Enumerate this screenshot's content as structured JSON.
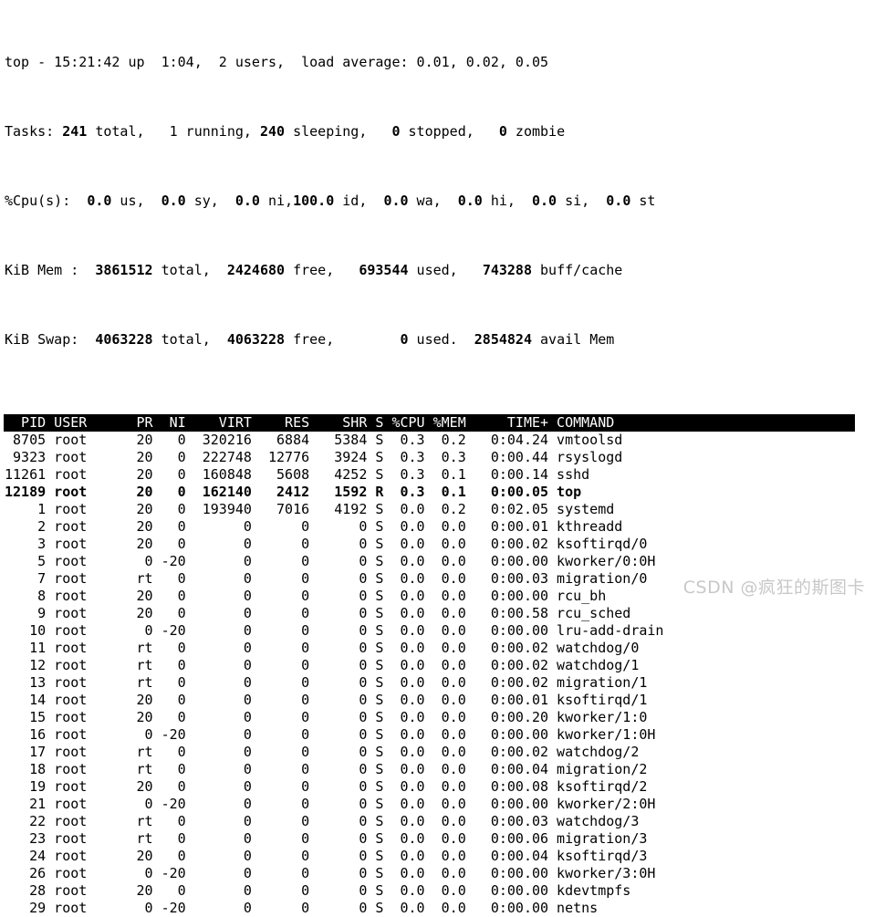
{
  "terminal": {
    "background": "#ffffff",
    "foreground": "#000000",
    "header_bar_background": "#000000",
    "header_bar_foreground": "#ffffff"
  },
  "summary": {
    "uptime_line": {
      "program": "top",
      "time": "15:21:42",
      "up": "1:04",
      "users": "2 users",
      "load_average": "0.01, 0.02, 0.05",
      "text_prefix": "top - 15:21:42 up  1:04,  2 users,  load average: ",
      "text_full": "top - 15:21:42 up  1:04,  2 users,  load average: 0.01, 0.02, 0.05"
    },
    "tasks_line": {
      "label": "Tasks:",
      "total": "241",
      "total_label": " total,   ",
      "running": "1",
      "running_label": " running, ",
      "sleeping": "240",
      "sleeping_label": " sleeping,   ",
      "stopped": "0",
      "stopped_label": " stopped,   ",
      "zombie": "0",
      "zombie_label": " zombie"
    },
    "cpu_line": {
      "label": "%Cpu(s):  ",
      "us": "0.0",
      "us_label": " us,  ",
      "sy": "0.0",
      "sy_label": " sy,  ",
      "ni": "0.0",
      "ni_label": " ni,",
      "id": "100.0",
      "id_label": " id,  ",
      "wa": "0.0",
      "wa_label": " wa,  ",
      "hi": "0.0",
      "hi_label": " hi,  ",
      "si": "0.0",
      "si_label": " si,  ",
      "st": "0.0",
      "st_label": " st"
    },
    "mem_line": {
      "label": "KiB Mem :  ",
      "total": "3861512",
      "total_label": " total,  ",
      "free": "2424680",
      "free_label": " free,   ",
      "used": "693544",
      "used_label": " used,   ",
      "buffcache": "743288",
      "buffcache_label": " buff/cache"
    },
    "swap_line": {
      "label": "KiB Swap:  ",
      "total": "4063228",
      "total_label": " total,  ",
      "free": "4063228",
      "free_label": " free,        ",
      "used": "0",
      "used_label": " used.  ",
      "avail": "2854824",
      "avail_label": " avail Mem"
    }
  },
  "table": {
    "header_text": "  PID USER      PR  NI    VIRT    RES    SHR S %CPU %MEM     TIME+ COMMAND                  ",
    "columns": [
      "PID",
      "USER",
      "PR",
      "NI",
      "VIRT",
      "RES",
      "SHR",
      "S",
      "%CPU",
      "%MEM",
      "TIME+",
      "COMMAND"
    ],
    "rows": [
      {
        "line": " 8705 root      20   0  320216   6884   5384 S  0.3  0.2   0:04.24 vmtoolsd",
        "pid": "8705",
        "user": "root",
        "pr": "20",
        "ni": "0",
        "virt": "320216",
        "res": "6884",
        "shr": "5384",
        "s": "S",
        "cpu": "0.3",
        "mem": "0.2",
        "time": "0:04.24",
        "command": "vmtoolsd",
        "bold": false
      },
      {
        "line": " 9323 root      20   0  222748  12776   3924 S  0.3  0.3   0:00.44 rsyslogd",
        "pid": "9323",
        "user": "root",
        "pr": "20",
        "ni": "0",
        "virt": "222748",
        "res": "12776",
        "shr": "3924",
        "s": "S",
        "cpu": "0.3",
        "mem": "0.3",
        "time": "0:00.44",
        "command": "rsyslogd",
        "bold": false
      },
      {
        "line": "11261 root      20   0  160848   5608   4252 S  0.3  0.1   0:00.14 sshd",
        "pid": "11261",
        "user": "root",
        "pr": "20",
        "ni": "0",
        "virt": "160848",
        "res": "5608",
        "shr": "4252",
        "s": "S",
        "cpu": "0.3",
        "mem": "0.1",
        "time": "0:00.14",
        "command": "sshd",
        "bold": false
      },
      {
        "line": "12189 root      20   0  162140   2412   1592 R  0.3  0.1   0:00.05 top",
        "pid": "12189",
        "user": "root",
        "pr": "20",
        "ni": "0",
        "virt": "162140",
        "res": "2412",
        "shr": "1592",
        "s": "R",
        "cpu": "0.3",
        "mem": "0.1",
        "time": "0:00.05",
        "command": "top",
        "bold": true
      },
      {
        "line": "    1 root      20   0  193940   7016   4192 S  0.0  0.2   0:02.05 systemd",
        "pid": "1",
        "user": "root",
        "pr": "20",
        "ni": "0",
        "virt": "193940",
        "res": "7016",
        "shr": "4192",
        "s": "S",
        "cpu": "0.0",
        "mem": "0.2",
        "time": "0:02.05",
        "command": "systemd",
        "bold": false
      },
      {
        "line": "    2 root      20   0       0      0      0 S  0.0  0.0   0:00.01 kthreadd",
        "pid": "2",
        "user": "root",
        "pr": "20",
        "ni": "0",
        "virt": "0",
        "res": "0",
        "shr": "0",
        "s": "S",
        "cpu": "0.0",
        "mem": "0.0",
        "time": "0:00.01",
        "command": "kthreadd",
        "bold": false
      },
      {
        "line": "    3 root      20   0       0      0      0 S  0.0  0.0   0:00.02 ksoftirqd/0",
        "pid": "3",
        "user": "root",
        "pr": "20",
        "ni": "0",
        "virt": "0",
        "res": "0",
        "shr": "0",
        "s": "S",
        "cpu": "0.0",
        "mem": "0.0",
        "time": "0:00.02",
        "command": "ksoftirqd/0",
        "bold": false
      },
      {
        "line": "    5 root       0 -20       0      0      0 S  0.0  0.0   0:00.00 kworker/0:0H",
        "pid": "5",
        "user": "root",
        "pr": "0",
        "ni": "-20",
        "virt": "0",
        "res": "0",
        "shr": "0",
        "s": "S",
        "cpu": "0.0",
        "mem": "0.0",
        "time": "0:00.00",
        "command": "kworker/0:0H",
        "bold": false
      },
      {
        "line": "    7 root      rt   0       0      0      0 S  0.0  0.0   0:00.03 migration/0",
        "pid": "7",
        "user": "root",
        "pr": "rt",
        "ni": "0",
        "virt": "0",
        "res": "0",
        "shr": "0",
        "s": "S",
        "cpu": "0.0",
        "mem": "0.0",
        "time": "0:00.03",
        "command": "migration/0",
        "bold": false
      },
      {
        "line": "    8 root      20   0       0      0      0 S  0.0  0.0   0:00.00 rcu_bh",
        "pid": "8",
        "user": "root",
        "pr": "20",
        "ni": "0",
        "virt": "0",
        "res": "0",
        "shr": "0",
        "s": "S",
        "cpu": "0.0",
        "mem": "0.0",
        "time": "0:00.00",
        "command": "rcu_bh",
        "bold": false
      },
      {
        "line": "    9 root      20   0       0      0      0 S  0.0  0.0   0:00.58 rcu_sched",
        "pid": "9",
        "user": "root",
        "pr": "20",
        "ni": "0",
        "virt": "0",
        "res": "0",
        "shr": "0",
        "s": "S",
        "cpu": "0.0",
        "mem": "0.0",
        "time": "0:00.58",
        "command": "rcu_sched",
        "bold": false
      },
      {
        "line": "   10 root       0 -20       0      0      0 S  0.0  0.0   0:00.00 lru-add-drain",
        "pid": "10",
        "user": "root",
        "pr": "0",
        "ni": "-20",
        "virt": "0",
        "res": "0",
        "shr": "0",
        "s": "S",
        "cpu": "0.0",
        "mem": "0.0",
        "time": "0:00.00",
        "command": "lru-add-drain",
        "bold": false
      },
      {
        "line": "   11 root      rt   0       0      0      0 S  0.0  0.0   0:00.02 watchdog/0",
        "pid": "11",
        "user": "root",
        "pr": "rt",
        "ni": "0",
        "virt": "0",
        "res": "0",
        "shr": "0",
        "s": "S",
        "cpu": "0.0",
        "mem": "0.0",
        "time": "0:00.02",
        "command": "watchdog/0",
        "bold": false
      },
      {
        "line": "   12 root      rt   0       0      0      0 S  0.0  0.0   0:00.02 watchdog/1",
        "pid": "12",
        "user": "root",
        "pr": "rt",
        "ni": "0",
        "virt": "0",
        "res": "0",
        "shr": "0",
        "s": "S",
        "cpu": "0.0",
        "mem": "0.0",
        "time": "0:00.02",
        "command": "watchdog/1",
        "bold": false
      },
      {
        "line": "   13 root      rt   0       0      0      0 S  0.0  0.0   0:00.02 migration/1",
        "pid": "13",
        "user": "root",
        "pr": "rt",
        "ni": "0",
        "virt": "0",
        "res": "0",
        "shr": "0",
        "s": "S",
        "cpu": "0.0",
        "mem": "0.0",
        "time": "0:00.02",
        "command": "migration/1",
        "bold": false
      },
      {
        "line": "   14 root      20   0       0      0      0 S  0.0  0.0   0:00.01 ksoftirqd/1",
        "pid": "14",
        "user": "root",
        "pr": "20",
        "ni": "0",
        "virt": "0",
        "res": "0",
        "shr": "0",
        "s": "S",
        "cpu": "0.0",
        "mem": "0.0",
        "time": "0:00.01",
        "command": "ksoftirqd/1",
        "bold": false
      },
      {
        "line": "   15 root      20   0       0      0      0 S  0.0  0.0   0:00.20 kworker/1:0",
        "pid": "15",
        "user": "root",
        "pr": "20",
        "ni": "0",
        "virt": "0",
        "res": "0",
        "shr": "0",
        "s": "S",
        "cpu": "0.0",
        "mem": "0.0",
        "time": "0:00.20",
        "command": "kworker/1:0",
        "bold": false
      },
      {
        "line": "   16 root       0 -20       0      0      0 S  0.0  0.0   0:00.00 kworker/1:0H",
        "pid": "16",
        "user": "root",
        "pr": "0",
        "ni": "-20",
        "virt": "0",
        "res": "0",
        "shr": "0",
        "s": "S",
        "cpu": "0.0",
        "mem": "0.0",
        "time": "0:00.00",
        "command": "kworker/1:0H",
        "bold": false
      },
      {
        "line": "   17 root      rt   0       0      0      0 S  0.0  0.0   0:00.02 watchdog/2",
        "pid": "17",
        "user": "root",
        "pr": "rt",
        "ni": "0",
        "virt": "0",
        "res": "0",
        "shr": "0",
        "s": "S",
        "cpu": "0.0",
        "mem": "0.0",
        "time": "0:00.02",
        "command": "watchdog/2",
        "bold": false
      },
      {
        "line": "   18 root      rt   0       0      0      0 S  0.0  0.0   0:00.04 migration/2",
        "pid": "18",
        "user": "root",
        "pr": "rt",
        "ni": "0",
        "virt": "0",
        "res": "0",
        "shr": "0",
        "s": "S",
        "cpu": "0.0",
        "mem": "0.0",
        "time": "0:00.04",
        "command": "migration/2",
        "bold": false
      },
      {
        "line": "   19 root      20   0       0      0      0 S  0.0  0.0   0:00.08 ksoftirqd/2",
        "pid": "19",
        "user": "root",
        "pr": "20",
        "ni": "0",
        "virt": "0",
        "res": "0",
        "shr": "0",
        "s": "S",
        "cpu": "0.0",
        "mem": "0.0",
        "time": "0:00.08",
        "command": "ksoftirqd/2",
        "bold": false
      },
      {
        "line": "   21 root       0 -20       0      0      0 S  0.0  0.0   0:00.00 kworker/2:0H",
        "pid": "21",
        "user": "root",
        "pr": "0",
        "ni": "-20",
        "virt": "0",
        "res": "0",
        "shr": "0",
        "s": "S",
        "cpu": "0.0",
        "mem": "0.0",
        "time": "0:00.00",
        "command": "kworker/2:0H",
        "bold": false
      },
      {
        "line": "   22 root      rt   0       0      0      0 S  0.0  0.0   0:00.03 watchdog/3",
        "pid": "22",
        "user": "root",
        "pr": "rt",
        "ni": "0",
        "virt": "0",
        "res": "0",
        "shr": "0",
        "s": "S",
        "cpu": "0.0",
        "mem": "0.0",
        "time": "0:00.03",
        "command": "watchdog/3",
        "bold": false
      },
      {
        "line": "   23 root      rt   0       0      0      0 S  0.0  0.0   0:00.06 migration/3",
        "pid": "23",
        "user": "root",
        "pr": "rt",
        "ni": "0",
        "virt": "0",
        "res": "0",
        "shr": "0",
        "s": "S",
        "cpu": "0.0",
        "mem": "0.0",
        "time": "0:00.06",
        "command": "migration/3",
        "bold": false
      },
      {
        "line": "   24 root      20   0       0      0      0 S  0.0  0.0   0:00.04 ksoftirqd/3",
        "pid": "24",
        "user": "root",
        "pr": "20",
        "ni": "0",
        "virt": "0",
        "res": "0",
        "shr": "0",
        "s": "S",
        "cpu": "0.0",
        "mem": "0.0",
        "time": "0:00.04",
        "command": "ksoftirqd/3",
        "bold": false
      },
      {
        "line": "   26 root       0 -20       0      0      0 S  0.0  0.0   0:00.00 kworker/3:0H",
        "pid": "26",
        "user": "root",
        "pr": "0",
        "ni": "-20",
        "virt": "0",
        "res": "0",
        "shr": "0",
        "s": "S",
        "cpu": "0.0",
        "mem": "0.0",
        "time": "0:00.00",
        "command": "kworker/3:0H",
        "bold": false
      },
      {
        "line": "   28 root      20   0       0      0      0 S  0.0  0.0   0:00.00 kdevtmpfs",
        "pid": "28",
        "user": "root",
        "pr": "20",
        "ni": "0",
        "virt": "0",
        "res": "0",
        "shr": "0",
        "s": "S",
        "cpu": "0.0",
        "mem": "0.0",
        "time": "0:00.00",
        "command": "kdevtmpfs",
        "bold": false
      },
      {
        "line": "   29 root       0 -20       0      0      0 S  0.0  0.0   0:00.00 netns",
        "pid": "29",
        "user": "root",
        "pr": "0",
        "ni": "-20",
        "virt": "0",
        "res": "0",
        "shr": "0",
        "s": "S",
        "cpu": "0.0",
        "mem": "0.0",
        "time": "0:00.00",
        "command": "netns",
        "bold": false
      }
    ]
  },
  "watermark": {
    "text": "CSDN @疯狂的斯图卡",
    "color": "#c8c8c8"
  }
}
